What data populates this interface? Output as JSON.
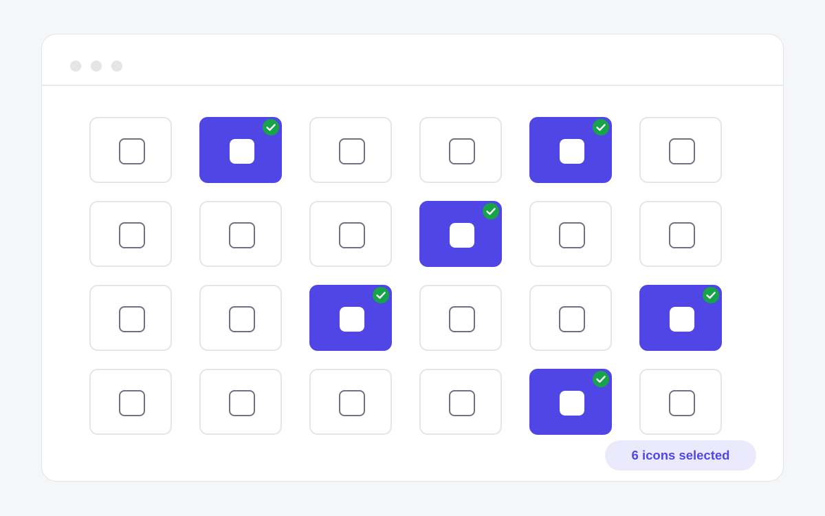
{
  "window_controls": [
    "dot",
    "dot",
    "dot"
  ],
  "accent_color": "#4f46e5",
  "check_color": "#16a34a",
  "icon_grid": {
    "icon": "rounded-square-icon",
    "rows": [
      [
        false,
        true,
        false,
        false,
        true,
        false
      ],
      [
        false,
        false,
        false,
        true,
        false,
        false
      ],
      [
        false,
        false,
        true,
        false,
        false,
        true
      ],
      [
        false,
        false,
        false,
        false,
        true,
        false
      ]
    ]
  },
  "status": {
    "label": "6 icons selected"
  }
}
